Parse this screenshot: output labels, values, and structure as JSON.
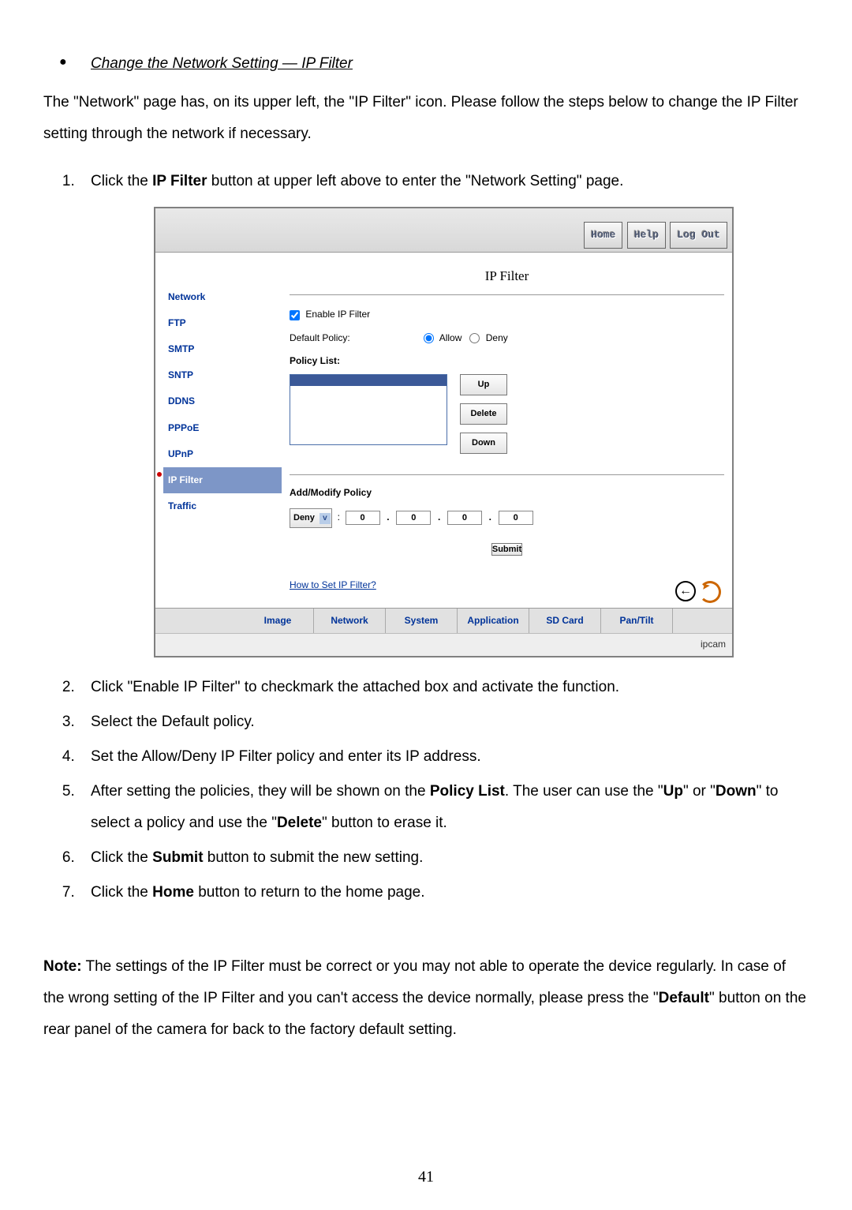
{
  "heading": "Change the Network Setting — IP Filter",
  "intro": "The \"Network\" page has, on its upper left, the \"IP Filter\" icon. Please follow the steps below to change the IP Filter setting through the network if necessary.",
  "steps": {
    "s1_a": "Click the ",
    "s1_b": "IP Filter",
    "s1_c": " button at upper left above to enter the \"Network Setting\" page.",
    "s2": "Click \"Enable IP Filter\" to checkmark the attached box and activate the function.",
    "s3": "Select the Default policy.",
    "s4": "Set the Allow/Deny IP Filter policy and enter its IP address.",
    "s5_a": "After setting the policies, they will be shown on the ",
    "s5_b": "Policy List",
    "s5_c": ". The user can use the \"",
    "s5_d": "Up",
    "s5_e": "\" or \"",
    "s5_f": "Down",
    "s5_g": "\" to select a policy and use the \"",
    "s5_h": "Delete",
    "s5_i": "\" button to erase it.",
    "s6_a": "Click the ",
    "s6_b": "Submit",
    "s6_c": " button to submit the new setting.",
    "s7_a": "Click the ",
    "s7_b": "Home",
    "s7_c": " button to return to the home page."
  },
  "note": {
    "a": "Note:",
    "b": " The settings of the IP Filter must be correct or you may not able to operate the device regularly. In case of the wrong setting of the IP Filter and you can't access the device normally, please press the \"",
    "c": "Default",
    "d": "\" button on the rear panel of the camera for back to the factory default setting."
  },
  "page_number": "41",
  "ui": {
    "topButtons": {
      "home": "Home",
      "help": "Help",
      "logout": "Log Out"
    },
    "title": "IP Filter",
    "sidebar": [
      "Network",
      "FTP",
      "SMTP",
      "SNTP",
      "DDNS",
      "PPPoE",
      "UPnP",
      "IP Filter",
      "Traffic"
    ],
    "sidebar_active_index": 7,
    "enable_label": "Enable IP Filter",
    "default_policy_label": "Default Policy:",
    "allow_label": "Allow",
    "deny_label": "Deny",
    "policy_list_label": "Policy List:",
    "btn_up": "Up",
    "btn_delete": "Delete",
    "btn_down": "Down",
    "add_modify_label": "Add/Modify Policy",
    "select_value": "Deny",
    "octet": "0",
    "btn_submit": "Submit",
    "howto": "How to Set IP Filter?",
    "back_arrow": "←",
    "tabs": [
      "Image",
      "Network",
      "System",
      "Application",
      "SD Card",
      "Pan/Tilt"
    ],
    "brand": "ipcam"
  }
}
